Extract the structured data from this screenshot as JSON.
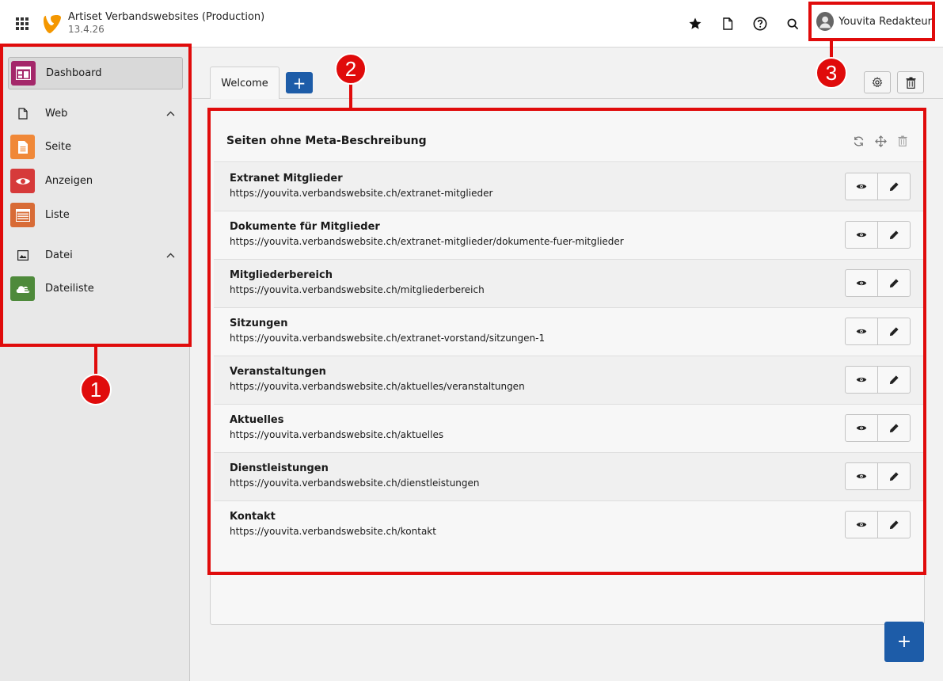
{
  "header": {
    "title": "Artiset Verbandswebsites (Production)",
    "version": "13.4.26",
    "user_name": "Youvita Redakteur",
    "icons": [
      "apps-grid-icon",
      "typo3-logo-icon",
      "star-icon",
      "document-icon",
      "help-icon",
      "search-icon",
      "user-avatar-icon"
    ]
  },
  "sidebar": {
    "dashboard": {
      "label": "Dashboard",
      "icon": "dashboard-icon",
      "color": "#a4276a"
    },
    "groups": [
      {
        "label": "Web",
        "icon": "page-outline-icon",
        "items": [
          {
            "label": "Seite",
            "icon": "page-icon",
            "color": "#f08838"
          },
          {
            "label": "Anzeigen",
            "icon": "eye-icon",
            "color": "#d63a3a"
          },
          {
            "label": "Liste",
            "icon": "list-icon",
            "color": "#d86b36"
          }
        ]
      },
      {
        "label": "Datei",
        "icon": "image-icon",
        "items": [
          {
            "label": "Dateiliste",
            "icon": "folder-cloud-icon",
            "color": "#4e8a3b"
          }
        ]
      }
    ]
  },
  "tabs": {
    "welcome": "Welcome",
    "add": "+"
  },
  "widget": {
    "title": "Seiten ohne Meta-Beschreibung",
    "rows": [
      {
        "title": "Extranet Mitglieder",
        "url": "https://youvita.verbandswebsite.ch/extranet-mitglieder"
      },
      {
        "title": "Dokumente für Mitglieder",
        "url": "https://youvita.verbandswebsite.ch/extranet-mitglieder/dokumente-fuer-mitglieder"
      },
      {
        "title": "Mitgliederbereich",
        "url": "https://youvita.verbandswebsite.ch/mitgliederbereich"
      },
      {
        "title": "Sitzungen",
        "url": "https://youvita.verbandswebsite.ch/extranet-vorstand/sitzungen-1"
      },
      {
        "title": "Veranstaltungen",
        "url": "https://youvita.verbandswebsite.ch/aktuelles/veranstaltungen"
      },
      {
        "title": "Aktuelles",
        "url": "https://youvita.verbandswebsite.ch/aktuelles"
      },
      {
        "title": "Dienstleistungen",
        "url": "https://youvita.verbandswebsite.ch/dienstleistungen"
      },
      {
        "title": "Kontakt",
        "url": "https://youvita.verbandswebsite.ch/kontakt"
      }
    ]
  },
  "fab": "+",
  "annotations": [
    "1",
    "2",
    "3"
  ],
  "colors": {
    "annotation_red": "#e00b0b",
    "primary_blue": "#1d5ca8"
  }
}
